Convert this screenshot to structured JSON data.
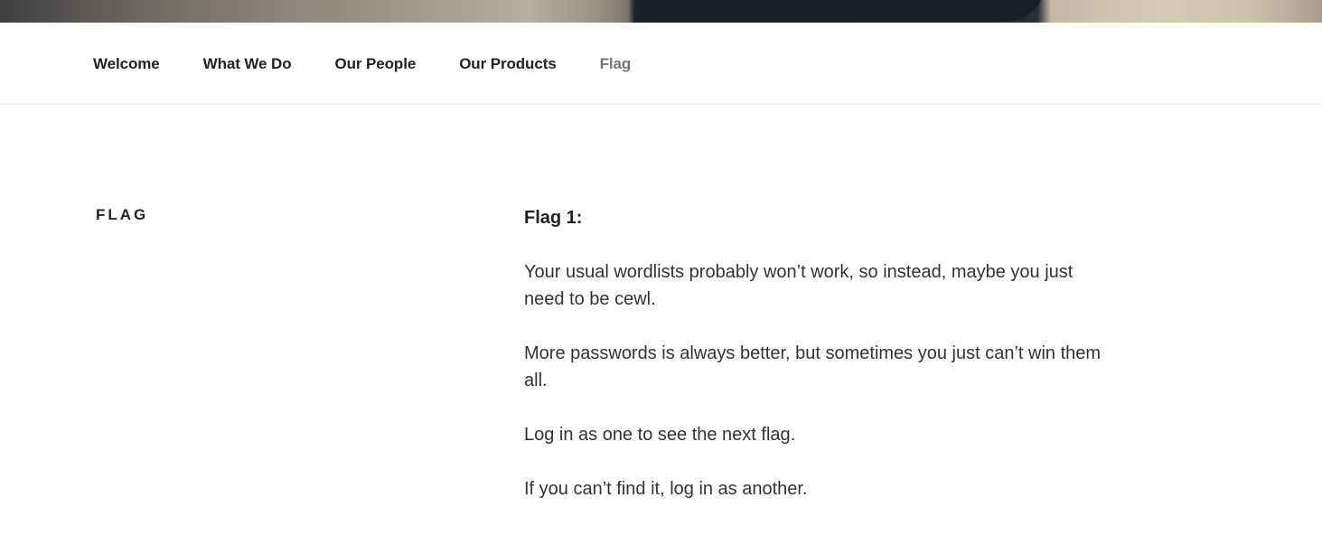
{
  "nav": {
    "items": [
      {
        "label": "Welcome"
      },
      {
        "label": "What We Do"
      },
      {
        "label": "Our People"
      },
      {
        "label": "Our Products"
      },
      {
        "label": "Flag",
        "current": true
      }
    ]
  },
  "page": {
    "title": "Flag",
    "content": {
      "heading": "Flag 1:",
      "paragraphs": [
        "Your usual wordlists probably won’t work, so instead, maybe you just need to be cewl.",
        "More passwords is always better, but sometimes you just can’t win them all.",
        "Log in as one to see the next flag.",
        "If you can’t find it, log in as another."
      ]
    }
  },
  "colors": {
    "nav_text": "#222222",
    "nav_current": "#767676",
    "body_text": "#333333"
  }
}
